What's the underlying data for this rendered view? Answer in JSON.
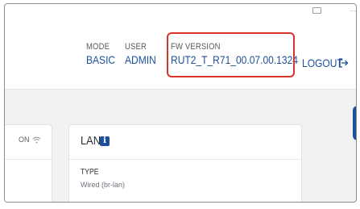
{
  "topbar": {
    "partial_text": "..."
  },
  "header": {
    "mode": {
      "label": "MODE",
      "value": "BASIC"
    },
    "user": {
      "label": "USER",
      "value": "ADMIN"
    },
    "fw_version": {
      "label": "FW VERSION",
      "value": "RUT2_T_R71_00.07.00.1324"
    },
    "logout_label": "LOGOUT",
    "highlight_color": "#d9342b"
  },
  "wifi_card": {
    "status": "ON"
  },
  "lan_card": {
    "title": "LAN",
    "info_glyph": "i",
    "type_label": "TYPE",
    "type_value": "Wired (br-lan)"
  },
  "colors": {
    "accent": "#1d4f9c",
    "label": "#555b62",
    "background": "#f2f2f2"
  }
}
